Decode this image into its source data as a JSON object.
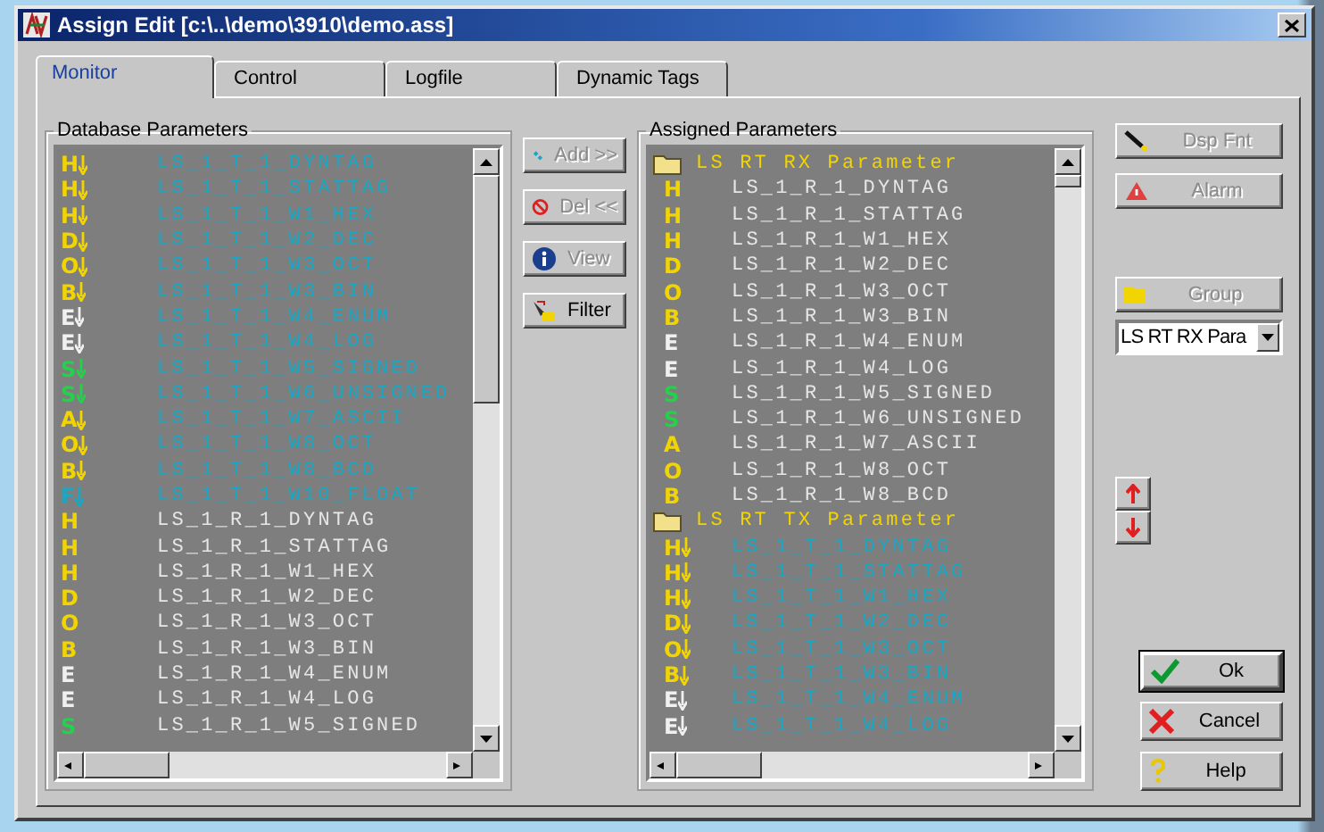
{
  "window": {
    "title": "Assign Edit [c:\\..\\demo\\3910\\demo.ass]"
  },
  "tabs": [
    {
      "label": "Monitor",
      "selected": true
    },
    {
      "label": "Control",
      "selected": false
    },
    {
      "label": "Logfile",
      "selected": false
    },
    {
      "label": "Dynamic Tags",
      "selected": false
    }
  ],
  "database_parameters": {
    "title": "Database Parameters",
    "items": [
      {
        "kind": "output",
        "code": "H",
        "color": "#f2d400",
        "name": "LS_1_T_1_DYNTAG"
      },
      {
        "kind": "output",
        "code": "H",
        "color": "#f2d400",
        "name": "LS_1_T_1_STATTAG"
      },
      {
        "kind": "output",
        "code": "H",
        "color": "#f2d400",
        "name": "LS_1_T_1_W1_HEX"
      },
      {
        "kind": "output",
        "code": "D",
        "color": "#f2d400",
        "name": "LS_1_T_1_W2_DEC"
      },
      {
        "kind": "output",
        "code": "O",
        "color": "#f2d400",
        "name": "LS_1_T_1_W3_OCT"
      },
      {
        "kind": "output",
        "code": "B",
        "color": "#f2d400",
        "name": "LS_1_T_1_W3_BIN"
      },
      {
        "kind": "output",
        "code": "E",
        "color": "#f0f0f0",
        "name": "LS_1_T_1_W4_ENUM"
      },
      {
        "kind": "output",
        "code": "E",
        "color": "#f0f0f0",
        "name": "LS_1_T_1_W4_LOG"
      },
      {
        "kind": "output",
        "code": "S",
        "color": "#22d24a",
        "name": "LS_1_T_1_W5_SIGNED"
      },
      {
        "kind": "output",
        "code": "S",
        "color": "#22d24a",
        "name": "LS_1_T_1_W6_UNSIGNED"
      },
      {
        "kind": "output",
        "code": "A",
        "color": "#f2d400",
        "name": "LS_1_T_1_W7_ASCII"
      },
      {
        "kind": "output",
        "code": "O",
        "color": "#f2d400",
        "name": "LS_1_T_1_W8_OCT"
      },
      {
        "kind": "output",
        "code": "B",
        "color": "#f2d400",
        "name": "LS_1_T_1_W8_BCD"
      },
      {
        "kind": "output",
        "code": "F",
        "color": "#1aa7c4",
        "name": "LS_1_T_1_W10_FLOAT"
      },
      {
        "kind": "input",
        "code": "H",
        "color": "#f2d400",
        "name": "LS_1_R_1_DYNTAG"
      },
      {
        "kind": "input",
        "code": "H",
        "color": "#f2d400",
        "name": "LS_1_R_1_STATTAG"
      },
      {
        "kind": "input",
        "code": "H",
        "color": "#f2d400",
        "name": "LS_1_R_1_W1_HEX"
      },
      {
        "kind": "input",
        "code": "D",
        "color": "#f2d400",
        "name": "LS_1_R_1_W2_DEC"
      },
      {
        "kind": "input",
        "code": "O",
        "color": "#f2d400",
        "name": "LS_1_R_1_W3_OCT"
      },
      {
        "kind": "input",
        "code": "B",
        "color": "#f2d400",
        "name": "LS_1_R_1_W3_BIN"
      },
      {
        "kind": "input",
        "code": "E",
        "color": "#f0f0f0",
        "name": "LS_1_R_1_W4_ENUM"
      },
      {
        "kind": "input",
        "code": "E",
        "color": "#f0f0f0",
        "name": "LS_1_R_1_W4_LOG"
      },
      {
        "kind": "input",
        "code": "S",
        "color": "#22d24a",
        "name": "LS_1_R_1_W5_SIGNED"
      }
    ]
  },
  "middle_buttons": [
    {
      "label": "Add >>",
      "disabled": true
    },
    {
      "label": "Del <<",
      "disabled": true
    },
    {
      "label": "View",
      "disabled": true
    },
    {
      "label": "Filter",
      "disabled": false
    }
  ],
  "assigned_parameters": {
    "title": "Assigned Parameters",
    "items": [
      {
        "kind": "group",
        "name": "LS RT RX Parameter"
      },
      {
        "kind": "input",
        "code": "H",
        "color": "#f2d400",
        "name": "LS_1_R_1_DYNTAG"
      },
      {
        "kind": "input",
        "code": "H",
        "color": "#f2d400",
        "name": "LS_1_R_1_STATTAG"
      },
      {
        "kind": "input",
        "code": "H",
        "color": "#f2d400",
        "name": "LS_1_R_1_W1_HEX"
      },
      {
        "kind": "input",
        "code": "D",
        "color": "#f2d400",
        "name": "LS_1_R_1_W2_DEC"
      },
      {
        "kind": "input",
        "code": "O",
        "color": "#f2d400",
        "name": "LS_1_R_1_W3_OCT"
      },
      {
        "kind": "input",
        "code": "B",
        "color": "#f2d400",
        "name": "LS_1_R_1_W3_BIN"
      },
      {
        "kind": "input",
        "code": "E",
        "color": "#f0f0f0",
        "name": "LS_1_R_1_W4_ENUM"
      },
      {
        "kind": "input",
        "code": "E",
        "color": "#f0f0f0",
        "name": "LS_1_R_1_W4_LOG"
      },
      {
        "kind": "input",
        "code": "S",
        "color": "#22d24a",
        "name": "LS_1_R_1_W5_SIGNED"
      },
      {
        "kind": "input",
        "code": "S",
        "color": "#22d24a",
        "name": "LS_1_R_1_W6_UNSIGNED"
      },
      {
        "kind": "input",
        "code": "A",
        "color": "#f2d400",
        "name": "LS_1_R_1_W7_ASCII"
      },
      {
        "kind": "input",
        "code": "O",
        "color": "#f2d400",
        "name": "LS_1_R_1_W8_OCT"
      },
      {
        "kind": "input",
        "code": "B",
        "color": "#f2d400",
        "name": "LS_1_R_1_W8_BCD"
      },
      {
        "kind": "group",
        "name": "LS RT TX Parameter"
      },
      {
        "kind": "output",
        "code": "H",
        "color": "#f2d400",
        "name": "LS_1_T_1_DYNTAG"
      },
      {
        "kind": "output",
        "code": "H",
        "color": "#f2d400",
        "name": "LS_1_T_1_STATTAG"
      },
      {
        "kind": "output",
        "code": "H",
        "color": "#f2d400",
        "name": "LS_1_T_1_W1_HEX"
      },
      {
        "kind": "output",
        "code": "D",
        "color": "#f2d400",
        "name": "LS_1_T_1_W2_DEC"
      },
      {
        "kind": "output",
        "code": "O",
        "color": "#f2d400",
        "name": "LS_1_T_1_W3_OCT"
      },
      {
        "kind": "output",
        "code": "B",
        "color": "#f2d400",
        "name": "LS_1_T_1_W3_BIN"
      },
      {
        "kind": "output",
        "code": "E",
        "color": "#f0f0f0",
        "name": "LS_1_T_1_W4_ENUM"
      },
      {
        "kind": "output",
        "code": "E",
        "color": "#f0f0f0",
        "name": "LS_1_T_1_W4_LOG"
      }
    ]
  },
  "side_buttons": [
    {
      "label": "Dsp Fnt",
      "disabled": true
    },
    {
      "label": "Alarm",
      "disabled": true
    }
  ],
  "group_button": {
    "label": "Group",
    "disabled": true
  },
  "group_select": {
    "value": "LS RT RX Para"
  },
  "dialog_buttons": [
    {
      "label": "Ok",
      "default": true
    },
    {
      "label": "Cancel",
      "default": false
    },
    {
      "label": "Help",
      "default": false
    }
  ]
}
